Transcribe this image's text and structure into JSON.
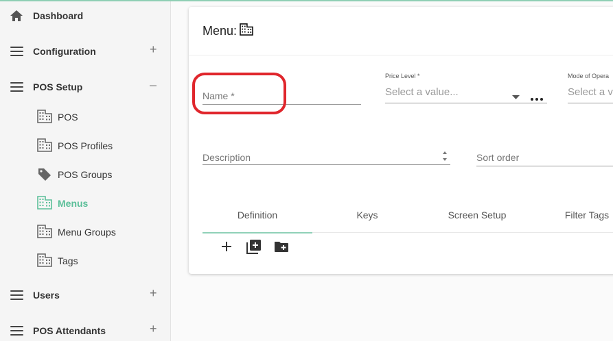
{
  "sidebar": {
    "dashboard": {
      "label": "Dashboard",
      "icon": "home-icon"
    },
    "configuration": {
      "label": "Configuration",
      "toggle": "+"
    },
    "pos_setup": {
      "label": "POS Setup",
      "toggle": "–",
      "items": [
        {
          "label": "POS",
          "icon": "building-icon",
          "active": false
        },
        {
          "label": "POS Profiles",
          "icon": "building-icon",
          "active": false
        },
        {
          "label": "POS Groups",
          "icon": "tag-icon",
          "active": false
        },
        {
          "label": "Menus",
          "icon": "building-icon",
          "active": true
        },
        {
          "label": "Menu Groups",
          "icon": "building-icon",
          "active": false
        },
        {
          "label": "Tags",
          "icon": "building-icon",
          "active": false
        }
      ]
    },
    "users": {
      "label": "Users",
      "toggle": "+"
    },
    "pos_attendants": {
      "label": "POS Attendants",
      "toggle": "+"
    }
  },
  "card": {
    "title": "Menu:",
    "title_icon": "building-icon",
    "fields": {
      "name": {
        "placeholder": "Name *"
      },
      "price_level": {
        "label": "Price Level *",
        "placeholder": "Select a value..."
      },
      "mode": {
        "label": "Mode of Opera",
        "placeholder": "Select a v"
      },
      "description": {
        "placeholder": "Description"
      },
      "sort_order": {
        "placeholder": "Sort order"
      }
    },
    "tabs": [
      "Definition",
      "Keys",
      "Screen Setup",
      "Filter Tags"
    ],
    "active_tab": "Definition",
    "toolbar": [
      "add-icon",
      "add-box-icon",
      "add-folder-icon"
    ]
  },
  "colors": {
    "accent": "#5bbf99",
    "highlight": "#e0262c"
  }
}
